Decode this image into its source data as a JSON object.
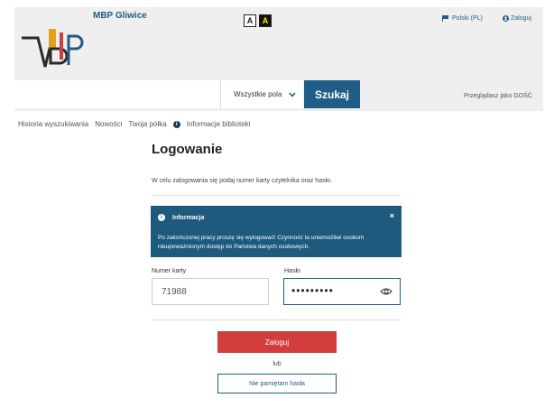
{
  "header": {
    "library_name": "MBP Gliwice",
    "contrast_normal": "A",
    "contrast_high": "A",
    "language": "Polski (PL)",
    "login": "Zaloguj"
  },
  "search": {
    "query": "",
    "field_select": "Wszystkie pola",
    "button": "Szukaj",
    "guest_text": "Przeglądasz jako GOŚĆ"
  },
  "nav": {
    "items": [
      "Historia wyszukiwania",
      "Nowości",
      "Twoja półka"
    ],
    "info": "Informacje biblioteki"
  },
  "login": {
    "title": "Logowanie",
    "intro": "W celu zalogowania się podaj numer karty czytelnika oraz hasło.",
    "alert_title": "Informacja",
    "alert_close": "×",
    "alert_body": "Po zakończonej pracy proszę się wylogować! Czynność ta uniemożliwi osobom nieupoważnionym dostęp do Państwa danych osobowych.",
    "card_label": "Numer karty",
    "card_value": "71988",
    "password_label": "Hasło",
    "password_value": "•••••••••",
    "submit": "Zaloguj",
    "or": "lub",
    "forgot": "Nie pamiętam hasła"
  },
  "icons": {
    "logo": "mbp-logo",
    "flag": "flag-icon",
    "user": "user-icon",
    "chevron": "chevron-down-icon",
    "info": "info-icon",
    "eye": "eye-icon"
  },
  "colors": {
    "brand_blue": "#1f5d86",
    "alert_blue": "#1d5a7e",
    "submit_red": "#d13c3c",
    "header_gray": "#efefef"
  }
}
